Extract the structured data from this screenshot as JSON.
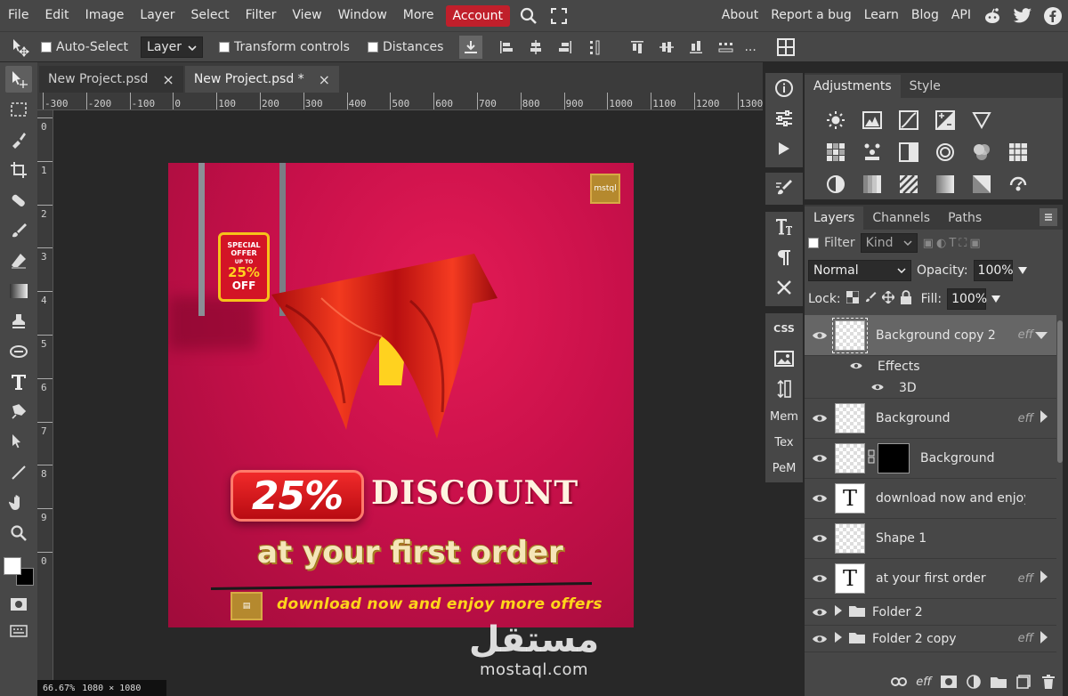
{
  "menu": {
    "items": [
      "File",
      "Edit",
      "Image",
      "Layer",
      "Select",
      "Filter",
      "View",
      "Window",
      "More"
    ],
    "account": "Account",
    "right_items": [
      "About",
      "Report a bug",
      "Learn",
      "Blog",
      "API"
    ]
  },
  "options": {
    "auto_select": "Auto-Select",
    "layer_select": "Layer",
    "transform_controls": "Transform controls",
    "distances": "Distances",
    "more": "..."
  },
  "tabs": [
    {
      "label": "New Project.psd",
      "close": "×"
    },
    {
      "label": "New Project.psd *",
      "close": "×"
    }
  ],
  "ruler": {
    "top": [
      "-300",
      "-200",
      "-100",
      "0",
      "100",
      "200",
      "300",
      "400",
      "500",
      "600",
      "700",
      "800",
      "900",
      "1000",
      "1100",
      "1200",
      "1300"
    ],
    "left": [
      "0",
      "1",
      "2",
      "3",
      "4",
      "5",
      "6",
      "7",
      "8",
      "9",
      "0"
    ]
  },
  "status": {
    "zoom": "66.67%",
    "size": "1080 × 1080"
  },
  "artwork": {
    "tag_line1": "SPECIAL",
    "tag_line2": "OFFER",
    "tag_line3": "UP TO",
    "tag_percent": "25%",
    "tag_off": "OFF",
    "badge": "25%",
    "discount": "DISCOUNT",
    "first_order": "at your first order",
    "download": "download now and enjoy more offers",
    "logo_text": "mstql"
  },
  "watermark": {
    "arabic": "مستقل",
    "latin": "mostaql.com"
  },
  "mini_panel": {
    "css": "CSS",
    "mem": "Mem",
    "tex": "Tex",
    "pem": "PeM"
  },
  "adjustments": {
    "tab_adjustments": "Adjustments",
    "tab_style": "Style"
  },
  "layers_panel": {
    "tab_layers": "Layers",
    "tab_channels": "Channels",
    "tab_paths": "Paths",
    "filter_label": "Filter",
    "kind": "Kind",
    "blend_mode": "Normal",
    "opacity_label": "Opacity:",
    "opacity_value": "100%",
    "lock_label": "Lock:",
    "fill_label": "Fill:",
    "fill_value": "100%",
    "eff_label": "eff",
    "layers": [
      {
        "name": "Background copy 2"
      },
      {
        "name": "Effects"
      },
      {
        "name": "3D"
      },
      {
        "name": "Background"
      },
      {
        "name": "Background"
      },
      {
        "name": "download now and enjoy"
      },
      {
        "name": "Shape 1"
      },
      {
        "name": "at your first order"
      },
      {
        "name": "Folder 2"
      },
      {
        "name": "Folder 2 copy"
      }
    ],
    "footer_eff": "eff"
  },
  "colors": {
    "accent": "#c01f2b",
    "canvas_bg": "#c8104a",
    "panel_bg": "#474747"
  }
}
